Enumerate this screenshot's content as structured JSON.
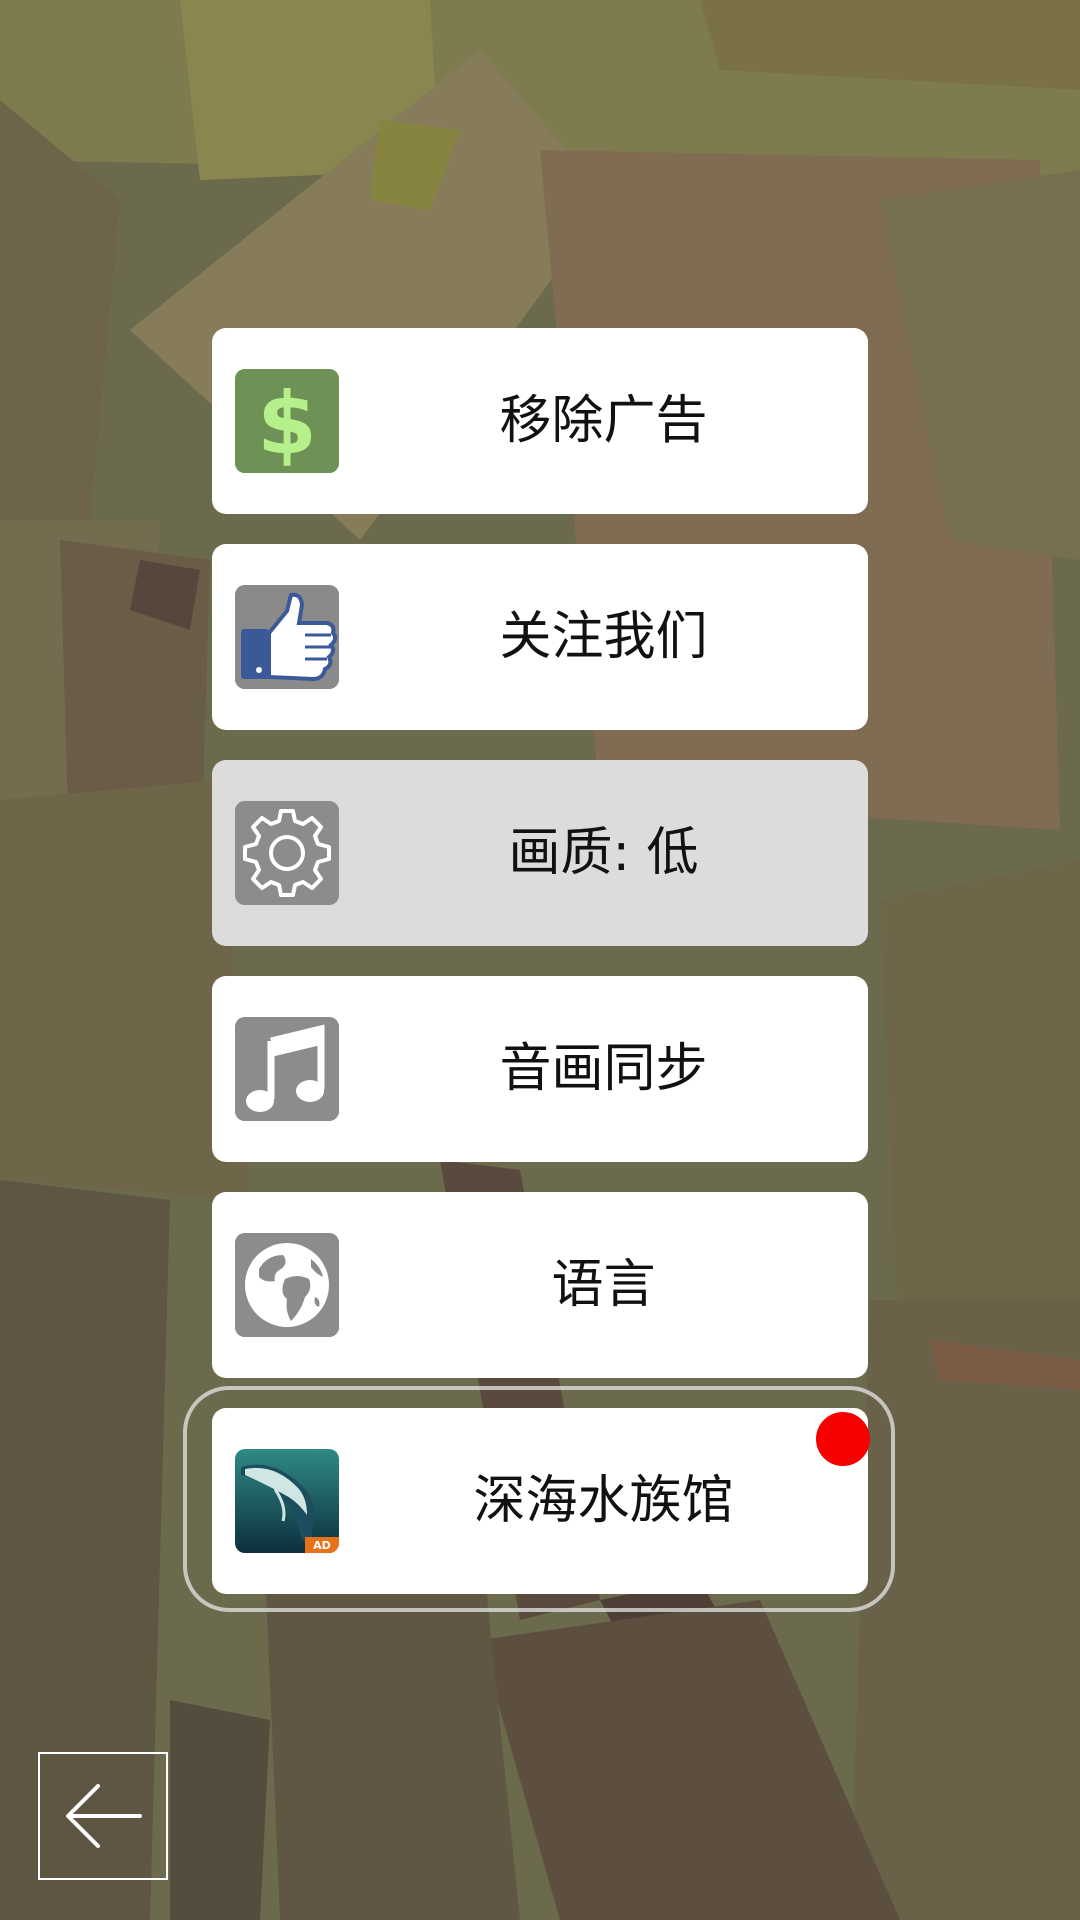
{
  "menu": {
    "items": [
      {
        "label": "移除广告",
        "icon": "dollar-icon",
        "icon_bg": "#6e9155",
        "icon_fg": "#b6f08a"
      },
      {
        "label": "关注我们",
        "icon": "thumbs-up-icon",
        "icon_bg": "#8a8a8a",
        "icon_fg": "#3b5998"
      },
      {
        "label": "画质: 低",
        "icon": "gear-icon",
        "icon_bg": "#8c8c8c",
        "icon_fg": "#ffffff",
        "state": "dimmed"
      },
      {
        "label": "音画同步",
        "icon": "music-note-icon",
        "icon_bg": "#8c8c8c",
        "icon_fg": "#ffffff"
      },
      {
        "label": "语言",
        "icon": "globe-icon",
        "icon_bg": "#8c8c8c",
        "icon_fg": "#ffffff"
      },
      {
        "label": "深海水族馆",
        "icon": "whale-app-icon",
        "badge": "AD",
        "badge_color": "#e8711b",
        "has_notification": true,
        "notification_color": "#f60000"
      }
    ]
  },
  "back_button": {
    "icon": "back-arrow-icon"
  }
}
